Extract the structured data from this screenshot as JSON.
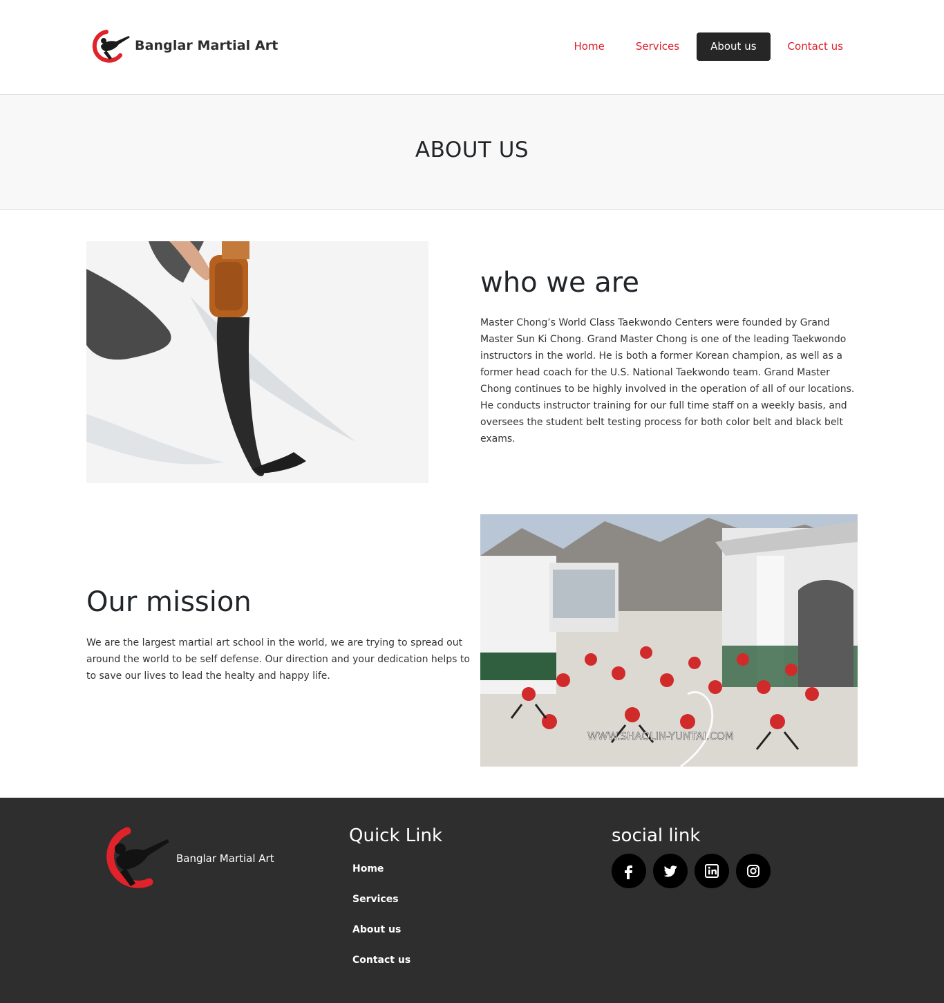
{
  "header": {
    "brand_name": "Banglar Martial Art",
    "logo_icon": "martial-artist-kick-logo",
    "nav": [
      {
        "label": "Home",
        "active": false
      },
      {
        "label": "Services",
        "active": false
      },
      {
        "label": "About us",
        "active": true
      },
      {
        "label": "Contact us",
        "active": false
      }
    ]
  },
  "banner": {
    "title": "ABOUT US"
  },
  "who_we_are": {
    "title": "who we are",
    "text": "Master Chong’s World Class Taekwondo Centers were founded by Grand Master Sun Ki Chong. Grand Master Chong is one of the leading Taekwondo instructors in the world. He is both a former Korean champion, as well as a former head coach for the U.S. National Taekwondo team. Grand Master Chong continues to be highly involved in the operation of all of our locations. He conducts instructor training for our full time staff on a weekly basis, and oversees the student belt testing process for both color belt and black belt exams.",
    "image": "calligraphy-brush-photo"
  },
  "mission": {
    "title": "Our mission",
    "text": "We are the largest martial art school in the world, we are trying to spread out around the world to be self defense. Our direction and your dedication helps to to save our lives to lead the healty and happy life.",
    "image": "kung-fu-students-training-photo",
    "image_watermark": "WWW.SHAOLIN-YUNTAI.COM"
  },
  "footer": {
    "brand_name": "Banglar Martial Art",
    "quick_link_title": "Quick Link",
    "quick_links": [
      "Home",
      "Services",
      "About us",
      "Contact us"
    ],
    "social_title": "social link",
    "social_icons": [
      "facebook-icon",
      "twitter-icon",
      "linkedin-icon",
      "instagram-icon"
    ]
  },
  "colors": {
    "accent_red": "#dc1f2a",
    "nav_active_bg": "#262626",
    "footer_bg": "#2e2e2e",
    "banner_bg": "#f8f8f8"
  }
}
